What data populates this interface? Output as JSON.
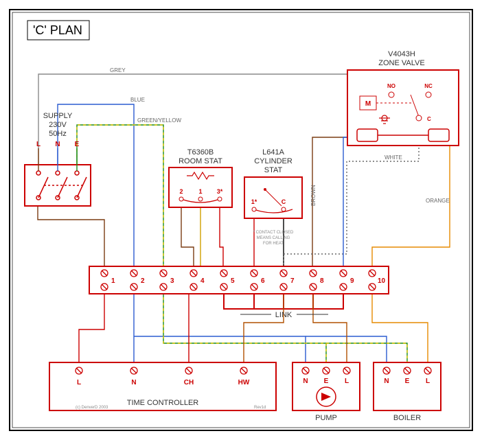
{
  "title": "'C' PLAN",
  "supply": {
    "label": "SUPPLY",
    "voltage": "230V",
    "freq": "50Hz",
    "L": "L",
    "N": "N",
    "E": "E"
  },
  "roomstat": {
    "model": "T6360B",
    "label": "ROOM STAT",
    "t1": "2",
    "t2": "1",
    "t3": "3*"
  },
  "cylstat": {
    "model": "L641A",
    "label": "CYLINDER",
    "label2": "STAT",
    "t1": "1*",
    "t2": "C",
    "note1": "* CONTACT CLOSED",
    "note2": "MEANS CALLING",
    "note3": "FOR HEAT"
  },
  "zonevalve": {
    "model": "V4043H",
    "label": "ZONE VALVE",
    "M": "M",
    "NO": "NO",
    "NC": "NC",
    "C": "C"
  },
  "junction": {
    "t1": "1",
    "t2": "2",
    "t3": "3",
    "t4": "4",
    "t5": "5",
    "t6": "6",
    "t7": "7",
    "t8": "8",
    "t9": "9",
    "t10": "10",
    "link": "LINK"
  },
  "timectrl": {
    "L": "L",
    "N": "N",
    "CH": "CH",
    "HW": "HW",
    "label": "TIME CONTROLLER"
  },
  "pump": {
    "N": "N",
    "E": "E",
    "L": "L",
    "label": "PUMP"
  },
  "boiler": {
    "N": "N",
    "E": "E",
    "L": "L",
    "label": "BOILER"
  },
  "wirecolors": {
    "grey": "GREY",
    "blue": "BLUE",
    "gy": "GREEN/YELLOW",
    "brown": "BROWN",
    "white": "WHITE",
    "orange": "ORANGE"
  },
  "footer": {
    "c": "(c) DenverD 2003",
    "rev": "Rev1d"
  }
}
